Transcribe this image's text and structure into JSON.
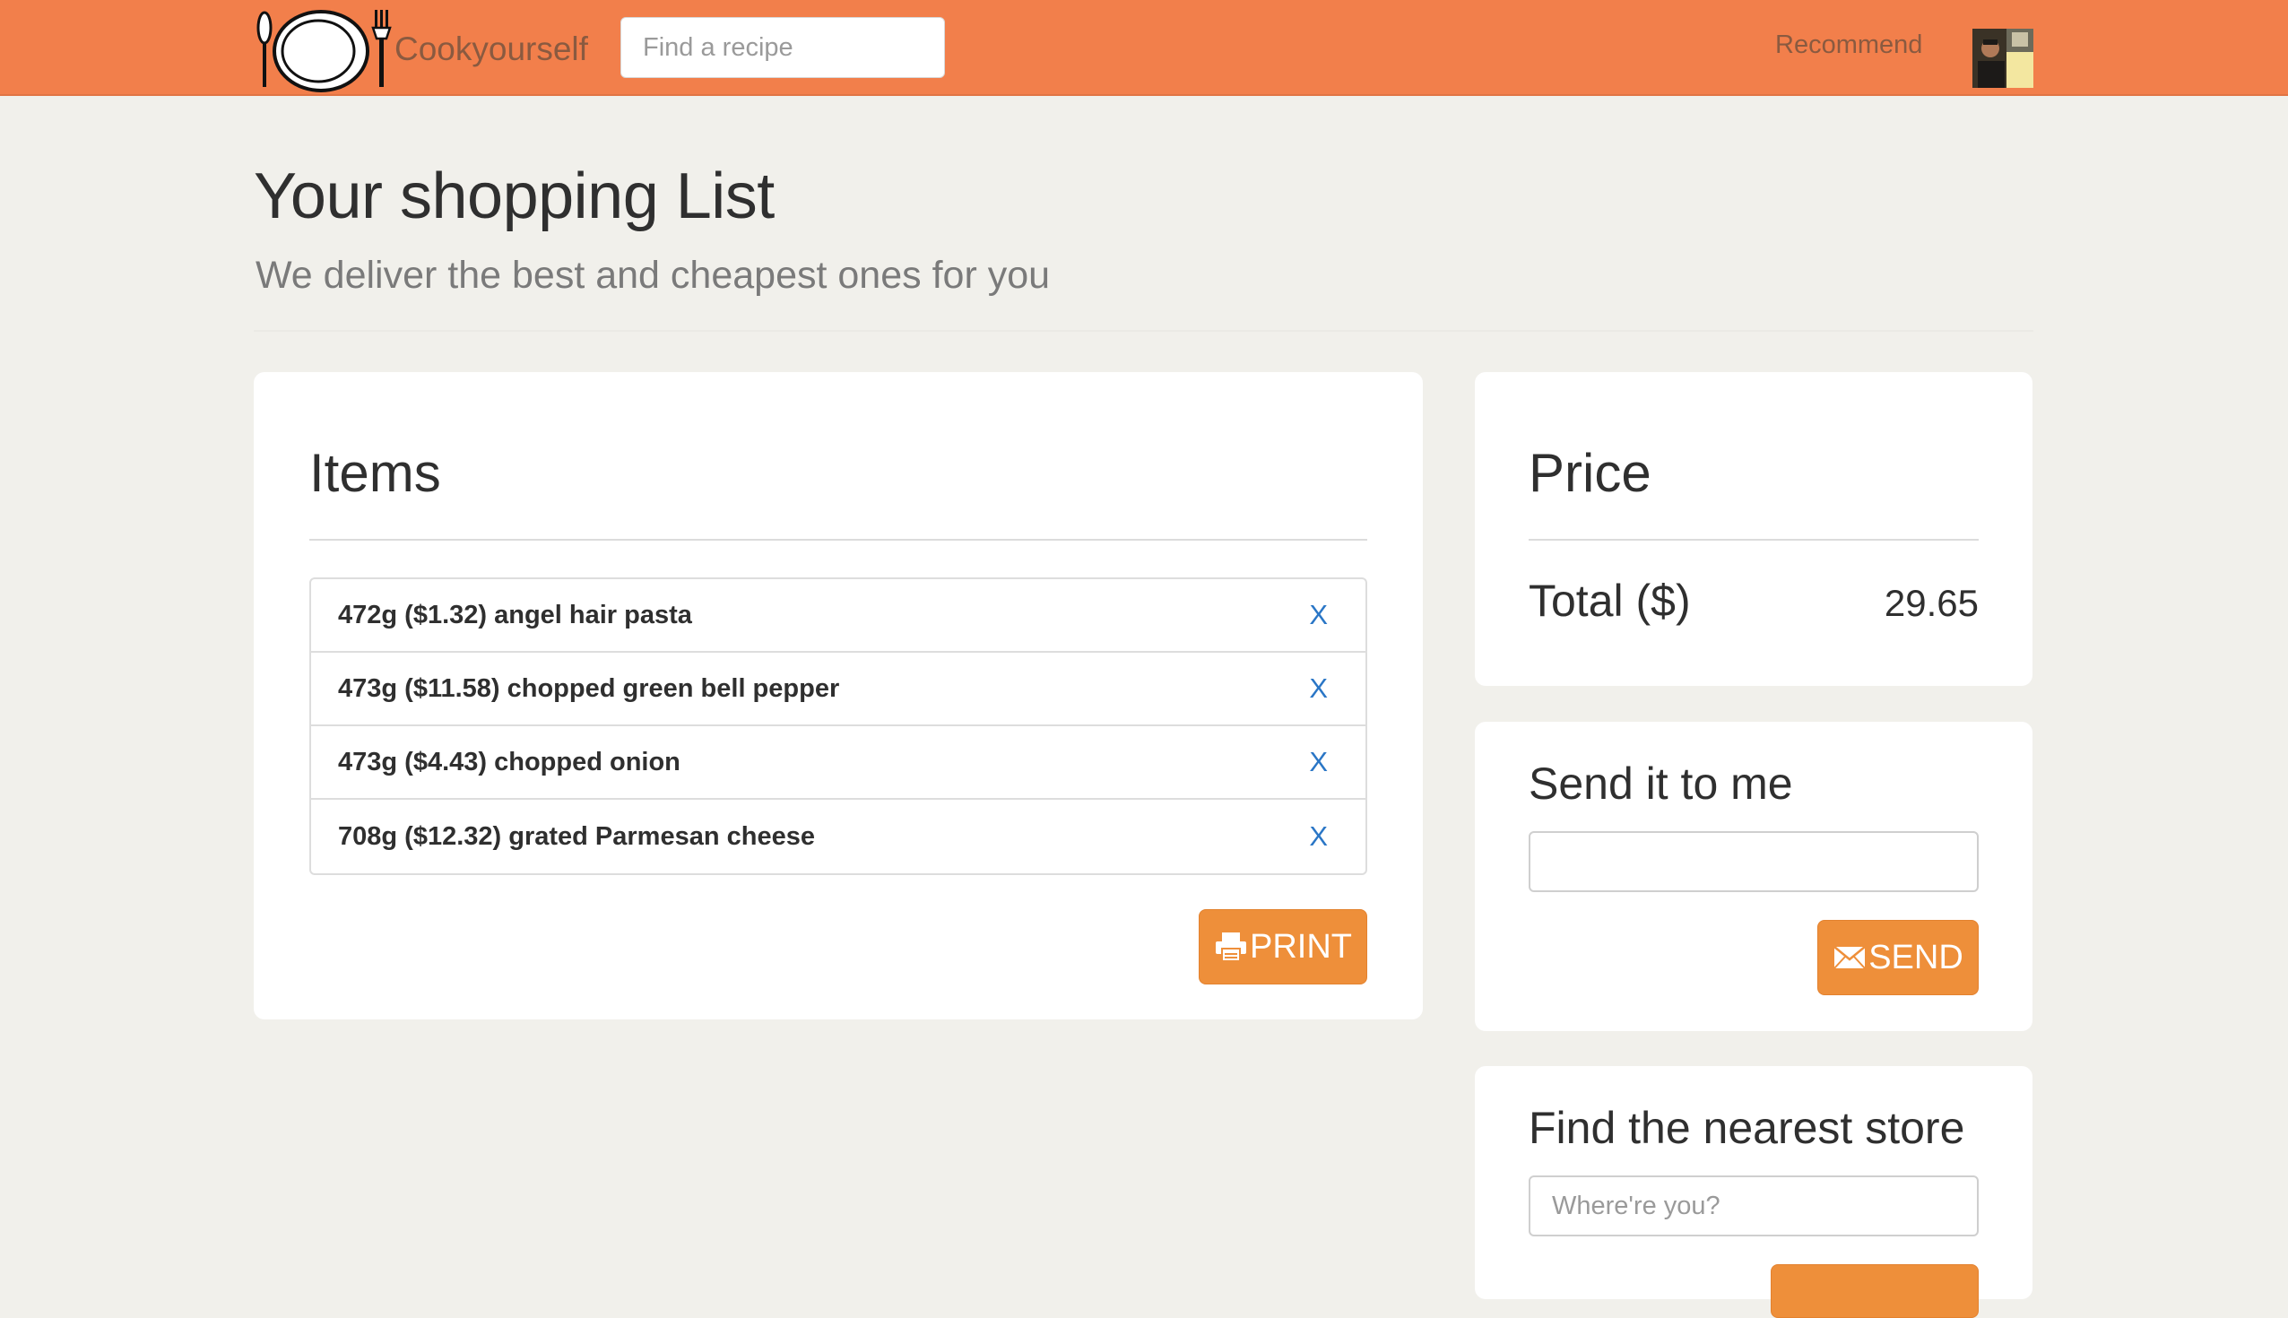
{
  "navbar": {
    "brand_name": "Cookyourself",
    "search_placeholder": "Find a recipe",
    "recommend_link": "Recommend",
    "color": "#f27f4b"
  },
  "page": {
    "title": "Your shopping List",
    "subtitle": "We deliver the best and cheapest ones for you"
  },
  "items_panel": {
    "heading": "Items",
    "items": [
      {
        "label": "472g ($1.32) angel hair pasta",
        "remove": "X"
      },
      {
        "label": "473g ($11.58) chopped green bell pepper",
        "remove": "X"
      },
      {
        "label": "473g ($4.43) chopped onion",
        "remove": "X"
      },
      {
        "label": "708g ($12.32) grated Parmesan cheese",
        "remove": "X"
      }
    ],
    "print_label": "PRINT",
    "print_icon": "printer-icon"
  },
  "price_panel": {
    "heading": "Price",
    "total_label": "Total ($)",
    "total_value": "29.65"
  },
  "send_panel": {
    "heading": "Send it to me",
    "email_value": "",
    "send_label": "SEND",
    "send_icon": "envelope-icon"
  },
  "store_panel": {
    "heading": "Find the nearest store",
    "location_placeholder": "Where're you?"
  },
  "colors": {
    "accent_button": "#ee8f3a",
    "remove_link": "#2a76c6",
    "background": "#f1f0eb"
  }
}
